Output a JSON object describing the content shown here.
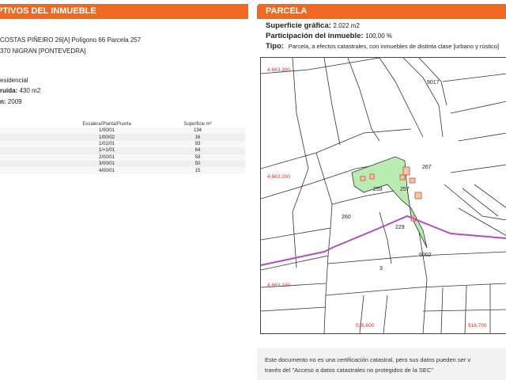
{
  "left": {
    "header": "PTIVOS DEL INMUEBLE",
    "address_line1": "COSTAS PIÑEIRO 26[A] Polígono 66 Parcela 257",
    "address_line2": "370 NIGRAN [PONTEVEDRA]",
    "use": "esidencial",
    "built_label": "ruida:",
    "built_value": "430 m2",
    "year_label": "n:",
    "year_value": "2009",
    "table": {
      "headers": [
        "Escalera/Planta/Puerta",
        "Superficie m²"
      ],
      "rows": [
        [
          "1/00/01",
          "134"
        ],
        [
          "1/00/02",
          "16"
        ],
        [
          "1/01/01",
          "93"
        ],
        [
          "1/+1/01",
          "64"
        ],
        [
          "2/00/01",
          "58"
        ],
        [
          "3/00/01",
          "50"
        ],
        [
          "4/00/01",
          "15"
        ]
      ]
    }
  },
  "right": {
    "header": "PARCELA",
    "surface_label": "Superficie gráfica:",
    "surface_value": "2.022 m2",
    "participation_label": "Participación del inmueble:",
    "participation_value": "100,00 %",
    "type_label": "Tipo:",
    "type_value": "Parcela, a efectos catastrales, con inmuebles de distinta clase [urbano y rústico]",
    "map": {
      "coords": [
        "4.663.300",
        "4.663.200",
        "4.663.100",
        "516.600",
        "516.700"
      ],
      "parcels": [
        "9017",
        "267",
        "259",
        "257",
        "260",
        "229",
        "9002",
        "3"
      ],
      "colors": {
        "highlight": "#b8ecb0",
        "boundary": "#b04cc0",
        "building": "#d24a3a"
      }
    },
    "footer_line1": "Este documento no es una certificación catastral, pero sus datos pueden ser v",
    "footer_line2": "través del \"Acceso a datos catastrales no protegidos de la SEC\""
  }
}
